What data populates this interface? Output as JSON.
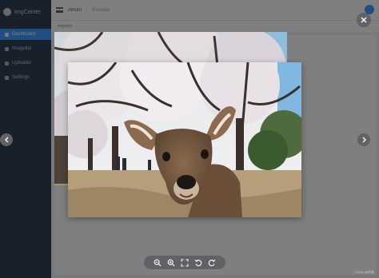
{
  "app": {
    "logo_text": "ImgCenter",
    "menu": [
      {
        "label": "Dashboard",
        "active": true
      },
      {
        "label": "Imagelist",
        "active": false
      },
      {
        "label": "Uploader",
        "active": false
      },
      {
        "label": "Settings",
        "active": false
      }
    ],
    "breadcrumb": {
      "root": "Album",
      "sep": "/",
      "current": "Preview"
    },
    "subbar_text": "imgview"
  },
  "viewer": {
    "icons": {
      "close": "close-icon",
      "prev": "arrow-left-icon",
      "next": "arrow-right-icon",
      "zoom_out": "zoom-out-icon",
      "zoom_in": "zoom-in-icon",
      "fit": "fullscreen-icon",
      "rotate_left": "rotate-left-icon",
      "rotate_right": "rotate-right-icon"
    },
    "overlay_color": "#000000",
    "button_color": "#606266"
  },
  "watermark": "CSDN @作者"
}
